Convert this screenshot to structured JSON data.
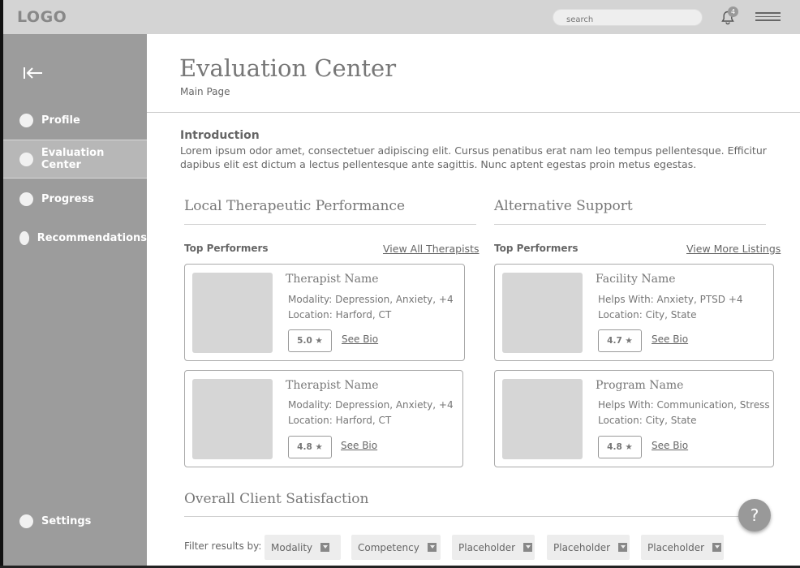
{
  "header": {
    "logo": "LOGO",
    "search_placeholder": "search",
    "notification_count": "4"
  },
  "sidebar": {
    "items": [
      {
        "label": "Profile"
      },
      {
        "label": "Evaluation Center"
      },
      {
        "label": "Progress"
      },
      {
        "label": "Recommendations"
      },
      {
        "label": "Settings"
      }
    ]
  },
  "page": {
    "title": "Evaluation Center",
    "subtitle": "Main Page"
  },
  "intro": {
    "heading": "Introduction",
    "text": "Lorem ipsum odor amet, consectetuer adipiscing elit. Cursus penatibus erat nam leo tempus pellentesque. Efficitur dapibus elit est dictum a lectus pellentesque ante sagittis. Nunc aptent egestas proin metus egestas."
  },
  "local": {
    "heading": "Local Therapeutic Performance",
    "top_label": "Top Performers",
    "view_link": "View All Therapists",
    "cards": [
      {
        "name": "Therapist Name",
        "line1": "Modality: Depression, Anxiety, +4",
        "line2": "Location: Harford, CT",
        "rating": "5.0",
        "bio": "See Bio"
      },
      {
        "name": "Therapist Name",
        "line1": "Modality: Depression, Anxiety, +4",
        "line2": "Location: Harford, CT",
        "rating": "4.8",
        "bio": "See Bio"
      }
    ]
  },
  "alternative": {
    "heading": "Alternative Support",
    "top_label": "Top Performers",
    "view_link": "View More Listings",
    "cards": [
      {
        "name": "Facility Name",
        "line1": "Helps With: Anxiety, PTSD +4",
        "line2": "Location: City, State",
        "rating": "4.7",
        "bio": "See Bio"
      },
      {
        "name": "Program Name",
        "line1": "Helps With: Communication, Stress",
        "line2": "Location: City, State",
        "rating": "4.8",
        "bio": "See Bio"
      }
    ]
  },
  "satisfaction": {
    "heading": "Overall Client Satisfaction",
    "filter_label": "Filter results by:",
    "filters": [
      "Modality",
      "Competency",
      "Placeholder",
      "Placeholder",
      "Placeholder"
    ]
  },
  "help_label": "?",
  "colors": {
    "topbar": "#d4d4d4",
    "sidebar": "#9c9c9c",
    "sidebar_active": "#b7b7b7",
    "placeholder": "#d6d6d6"
  }
}
